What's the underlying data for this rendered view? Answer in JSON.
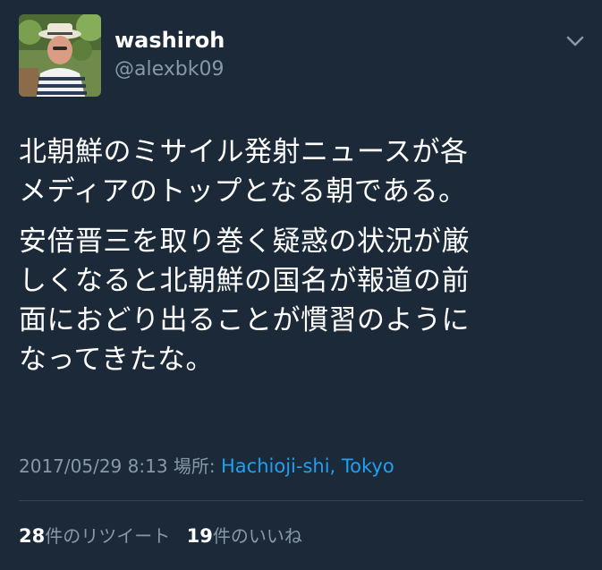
{
  "user": {
    "display_name": "washiroh",
    "handle": "@alexbk09"
  },
  "icons": {
    "avatar": "profile-photo",
    "caret": "chevron-down-icon"
  },
  "tweet": {
    "paragraphs": [
      "北朝鮮のミサイル発射ニュースが各\nメディアのトップとなる朝である。",
      "安倍晋三を取り巻く疑惑の状況が厳\nしくなると北朝鮮の国名が報道の前\n面におどり出ることが慣習のように\nなってきたな。"
    ]
  },
  "meta": {
    "timestamp": "2017/05/29 8:13",
    "location_label": "場所:",
    "location": "Hachioji-shi, Tokyo"
  },
  "stats": {
    "retweets_count": "28",
    "retweets_label": "件のリツイート",
    "likes_count": "19",
    "likes_label": "件のいいね"
  },
  "colors": {
    "background": "#1c2938",
    "text": "#ffffff",
    "secondary": "#8899a6",
    "link": "#1da1f2"
  }
}
